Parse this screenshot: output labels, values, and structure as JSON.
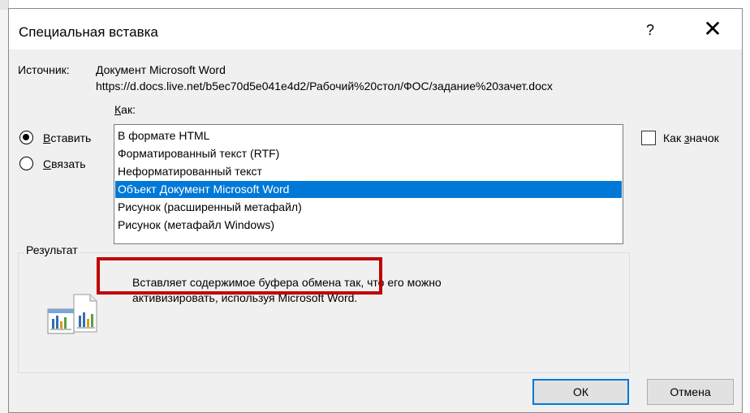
{
  "dialog": {
    "title": "Специальная вставка",
    "help_label": "?",
    "close_label": "✕",
    "source_label": "Источник:",
    "source_name": "Документ Microsoft Word",
    "source_path": "https://d.docs.live.net/b5ec70d5e041e4d2/Рабочий%20стол/ФОС/задание%20зачет.docx",
    "as_label": "Как:",
    "as_accel": "К",
    "as_rest": "ак:",
    "paste_option": {
      "accel": "В",
      "rest": "ставить",
      "selected": true
    },
    "link_option": {
      "accel": "С",
      "rest": "вязать",
      "selected": false
    },
    "formats": [
      {
        "label": "В формате HTML",
        "selected": false
      },
      {
        "label": "Форматированный текст (RTF)",
        "selected": false
      },
      {
        "label": "Неформатированный текст",
        "selected": false
      },
      {
        "label": "Объект Документ Microsoft Word",
        "selected": true
      },
      {
        "label": "Рисунок (расширенный метафайл)",
        "selected": false
      },
      {
        "label": "Рисунок (метафайл Windows)",
        "selected": false
      }
    ],
    "as_icon": {
      "prefix": "Как ",
      "accel": "з",
      "rest": "начок",
      "checked": false
    },
    "result_label": "Результат",
    "result_line1": "Вставляет содержимое буфера обмена так, что его можно",
    "result_line2": "активизировать, используя Microsoft Word.",
    "ok_label": "ОК",
    "cancel_label": "Отмена"
  },
  "colors": {
    "selection": "#0078d7",
    "highlight_box": "#c00000",
    "dialog_bg": "#f0f0f0"
  },
  "icons": [
    "document-object-icon"
  ]
}
